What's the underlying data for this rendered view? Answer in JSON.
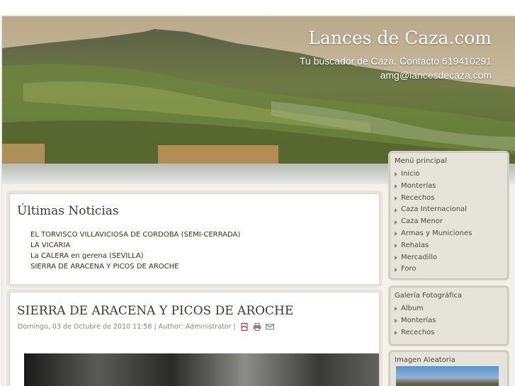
{
  "site": {
    "title": "Lances de Caza.com",
    "tagline": "Tu buscador de Caza. Contacto 619410291 amg@lancesdecaza.com"
  },
  "news": {
    "title": "Últimas Noticias",
    "items": [
      "EL TORVISCO VILLAVICIOSA DE CORDOBA (SEMI-CERRADA)",
      "LA VICARIA",
      "La CALERA en gerena (SEVILLA)",
      "SIERRA DE ARACENA Y PICOS DE AROCHE"
    ]
  },
  "article": {
    "title": "SIERRA DE ARACENA Y PICOS DE AROCHE",
    "meta": "Domingo, 03 de Octubre de 2010 11:58 | Author: Administrator |",
    "icons": [
      "pdf-icon",
      "print-icon",
      "email-icon"
    ]
  },
  "menu": {
    "title": "Menú principal",
    "items": [
      "Inicio",
      "Monterías",
      "Recechos",
      "Caza Internacional",
      "Caza Menor",
      "Armas y Municiones",
      "Rehalas",
      "Mercadillo",
      "Foro"
    ]
  },
  "gallery": {
    "title": "Galería Fotográfica",
    "items": [
      "Album",
      "Monterías",
      "Recechos"
    ]
  },
  "random_image": {
    "title": "Imagen Aleatoria"
  }
}
